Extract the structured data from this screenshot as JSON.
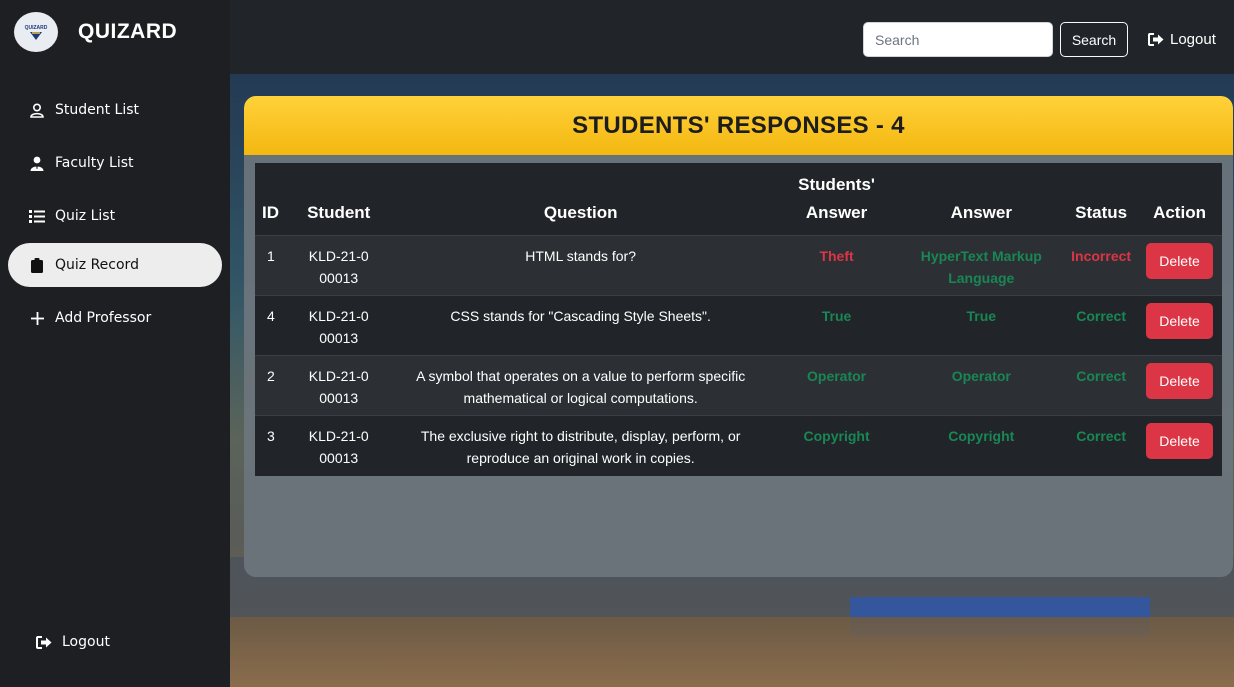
{
  "brand": {
    "logo_text": "QUIZARD",
    "title": "QUIZARD"
  },
  "sidebar": {
    "items": [
      {
        "label": "Student List",
        "icon": "user-outline-icon"
      },
      {
        "label": "Faculty List",
        "icon": "user-tie-icon"
      },
      {
        "label": "Quiz List",
        "icon": "list-icon"
      },
      {
        "label": "Quiz Record",
        "icon": "clipboard-icon",
        "active": true
      },
      {
        "label": "Add Professor",
        "icon": "plus-icon"
      }
    ],
    "logout_label": "Logout"
  },
  "topbar": {
    "search_placeholder": "Search",
    "search_button": "Search",
    "logout_label": "Logout"
  },
  "page": {
    "title": "STUDENTS' RESPONSES - 4"
  },
  "table": {
    "headers": [
      "ID",
      "Student",
      "Question",
      "Students' Answer",
      "Answer",
      "Status",
      "Action"
    ],
    "rows": [
      {
        "id": "1",
        "student": "KLD-21-000013",
        "question": "HTML stands for?",
        "student_answer": "Theft",
        "answer": "HyperText Markup Language",
        "status": "Incorrect",
        "action": "Delete"
      },
      {
        "id": "4",
        "student": "KLD-21-000013",
        "question": "CSS stands for \"Cascading Style Sheets\".",
        "student_answer": "True",
        "answer": "True",
        "status": "Correct",
        "action": "Delete"
      },
      {
        "id": "2",
        "student": "KLD-21-000013",
        "question": "A symbol that operates on a value to perform specific mathematical or logical computations.",
        "student_answer": "Operator",
        "answer": "Operator",
        "status": "Correct",
        "action": "Delete"
      },
      {
        "id": "3",
        "student": "KLD-21-000013",
        "question": "The exclusive right to distribute, display, perform, or reproduce an original work in copies.",
        "student_answer": "Copyright",
        "answer": "Copyright",
        "status": "Correct",
        "action": "Delete"
      }
    ]
  },
  "colors": {
    "accent": "#ffc107",
    "danger": "#dc3545",
    "success": "#198754",
    "sidebar": "#1e1f22",
    "topbar": "#212529"
  }
}
